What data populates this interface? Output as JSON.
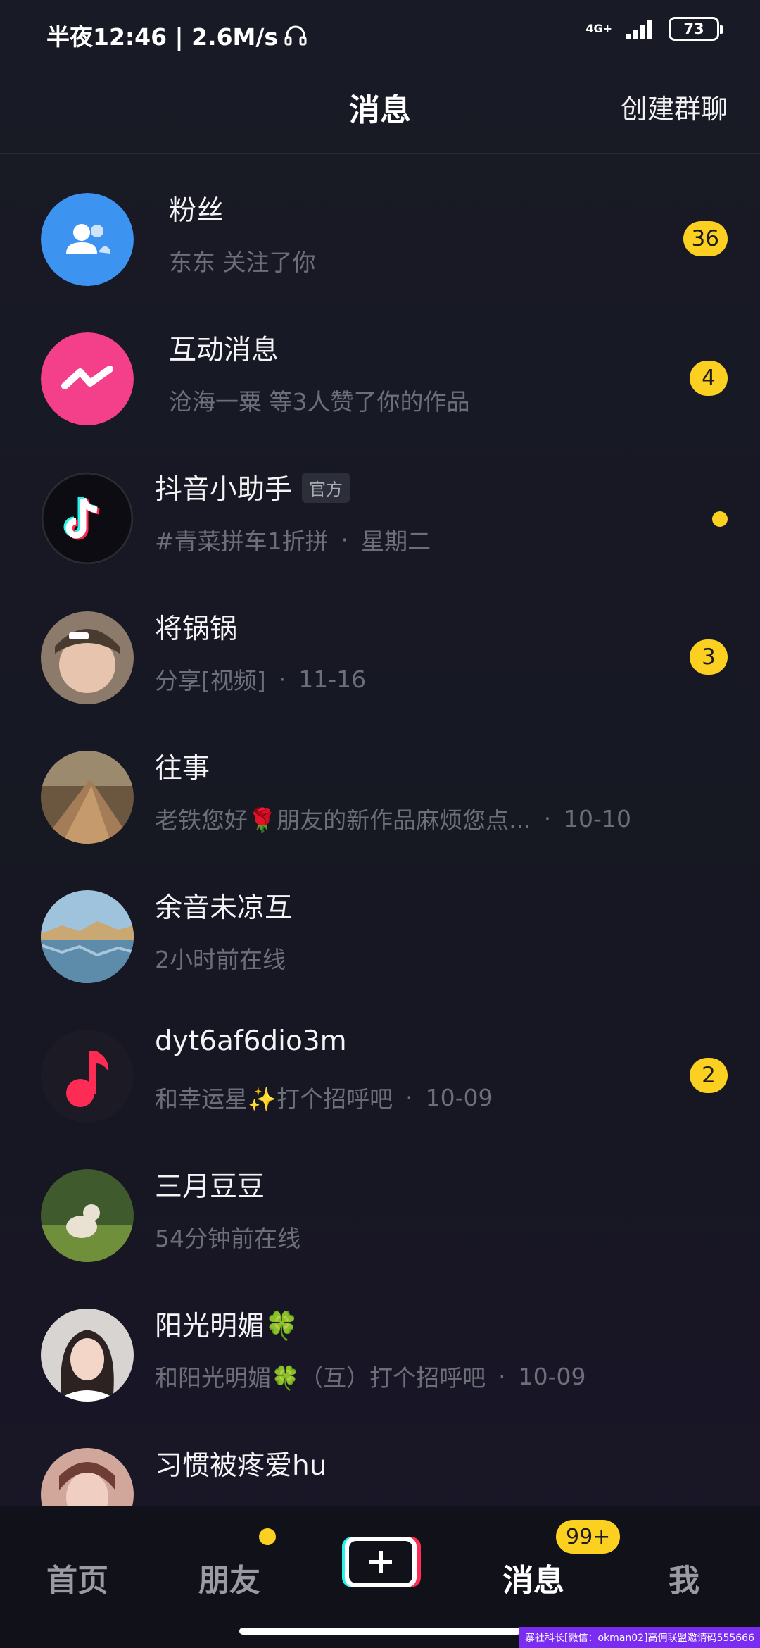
{
  "status_bar": {
    "time": "半夜12:46 | 2.6M/s",
    "network": "4G+",
    "battery": "73"
  },
  "header": {
    "title": "消息",
    "create_group": "创建群聊"
  },
  "conversations": [
    {
      "name": "粉丝",
      "subtitle": "东东 关注了你",
      "badge": "36"
    },
    {
      "name": "互动消息",
      "subtitle": "沧海一粟 等3人赞了你的作品",
      "badge": "4"
    },
    {
      "name": "抖音小助手",
      "tag": "官方",
      "subtitle": "#青菜拼车1折拼",
      "time": "星期二"
    },
    {
      "name": "将锅锅",
      "subtitle": "分享[视频]",
      "time": "11-16",
      "badge": "3"
    },
    {
      "name": "往事",
      "subtitle": "老铁您好🌹朋友的新作品麻烦您点...",
      "time": "10-10"
    },
    {
      "name": "余音未凉互",
      "subtitle": "2小时前在线"
    },
    {
      "name": "dyt6af6dio3m",
      "subtitle": "和幸运星✨打个招呼吧",
      "time": "10-09",
      "badge": "2"
    },
    {
      "name": "三月豆豆",
      "subtitle": "54分钟前在线"
    },
    {
      "name": "阳光明媚🍀",
      "subtitle": "和阳光明媚🍀（互）打个招呼吧",
      "time": "10-09"
    },
    {
      "name": "习惯被疼爱hu"
    }
  ],
  "bottom_nav": {
    "home": "首页",
    "friends": "朋友",
    "messages": "消息",
    "messages_badge": "99+",
    "me": "我"
  },
  "watermark": "寨社科长[微信：okman02]高佣联盟邀请码555666",
  "colors": {
    "background": "#161823",
    "badge": "#fbd020",
    "subtitle": "#6c6e78"
  }
}
